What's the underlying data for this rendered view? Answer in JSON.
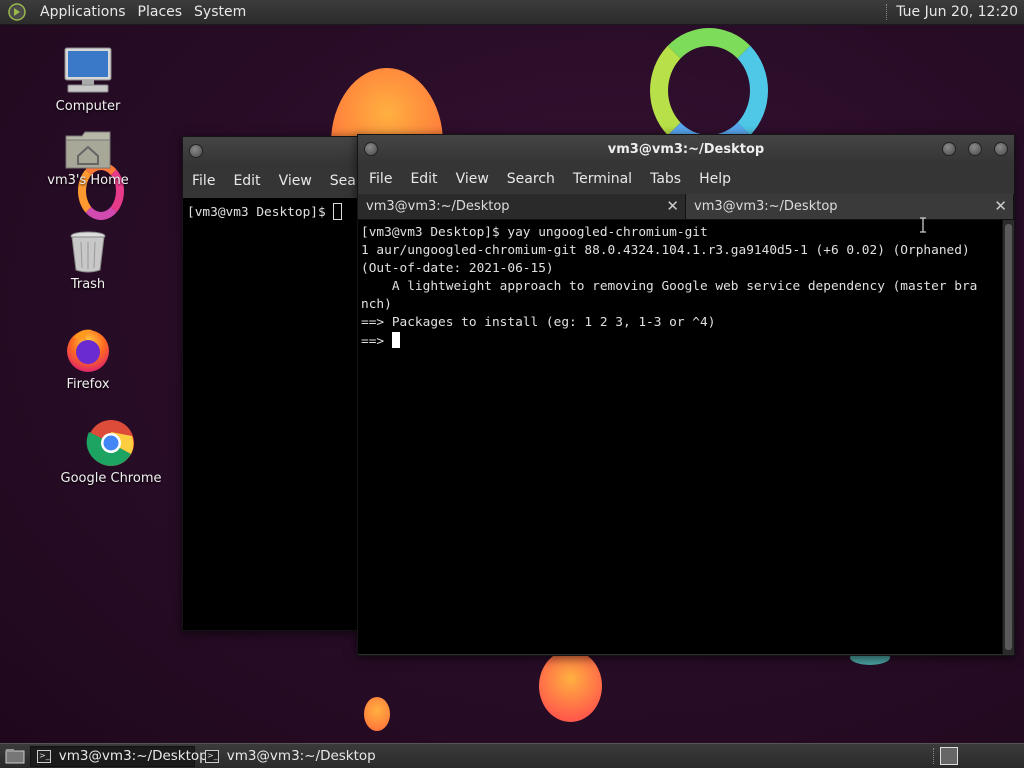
{
  "top_panel": {
    "menus": [
      "Applications",
      "Places",
      "System"
    ],
    "clock": "Tue Jun 20, 12:20"
  },
  "desktop_icons": [
    {
      "label": "Computer",
      "icon": "computer-icon"
    },
    {
      "label": "vm3's Home",
      "icon": "home-folder-icon"
    },
    {
      "label": "Trash",
      "icon": "trash-icon"
    },
    {
      "label": "Firefox",
      "icon": "firefox-icon"
    },
    {
      "label": "Google Chrome",
      "icon": "chrome-icon"
    }
  ],
  "back_window": {
    "menus": [
      "File",
      "Edit",
      "View",
      "Search"
    ],
    "prompt": "[vm3@vm3 Desktop]$ "
  },
  "front_window": {
    "title": "vm3@vm3:~/Desktop",
    "menus": [
      "File",
      "Edit",
      "View",
      "Search",
      "Terminal",
      "Tabs",
      "Help"
    ],
    "tabs": [
      {
        "label": "vm3@vm3:~/Desktop",
        "active": false
      },
      {
        "label": "vm3@vm3:~/Desktop",
        "active": true
      }
    ],
    "lines": [
      "[vm3@vm3 Desktop]$ yay ungoogled-chromium-git",
      "1 aur/ungoogled-chromium-git 88.0.4324.104.1.r3.ga9140d5-1 (+6 0.02) (Orphaned)",
      "(Out-of-date: 2021-06-15)",
      "    A lightweight approach to removing Google web service dependency (master bra",
      "nch)",
      "==> Packages to install (eg: 1 2 3, 1-3 or ^4)",
      "==> "
    ]
  },
  "taskbar": {
    "tasks": [
      {
        "label": "vm3@vm3:~/Desktop",
        "active": true
      },
      {
        "label": "vm3@vm3:~/Desktop",
        "active": false
      }
    ]
  },
  "colors": {
    "desktop_bg": "#2a0d28",
    "terminal_bg": "#000000",
    "panel_bg": "#333333"
  }
}
